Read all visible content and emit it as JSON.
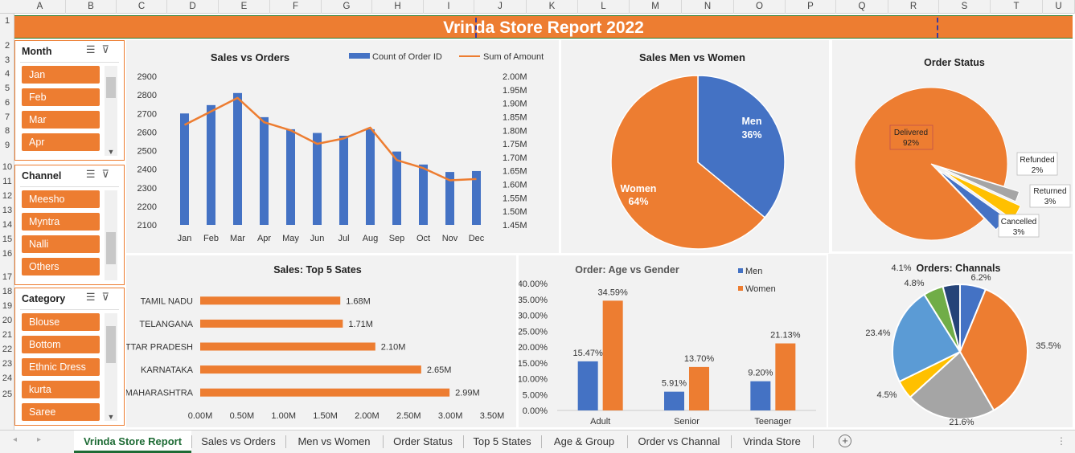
{
  "columns": [
    "A",
    "B",
    "C",
    "D",
    "E",
    "F",
    "G",
    "H",
    "I",
    "J",
    "K",
    "L",
    "M",
    "N",
    "O",
    "P",
    "Q",
    "R",
    "S",
    "T",
    "U"
  ],
  "rows": [
    "1",
    "2",
    "3",
    "4",
    "5",
    "6",
    "7",
    "8",
    "9",
    "10",
    "11",
    "12",
    "13",
    "14",
    "15",
    "16",
    "17",
    "18",
    "19",
    "20",
    "21",
    "22",
    "23",
    "24",
    "25"
  ],
  "report_title": "Vrinda Store Report 2022",
  "slicers": {
    "month": {
      "title": "Month",
      "items": [
        "Jan",
        "Feb",
        "Mar",
        "Apr"
      ]
    },
    "channel": {
      "title": "Channel",
      "items": [
        "Meesho",
        "Myntra",
        "Nalli",
        "Others"
      ]
    },
    "category": {
      "title": "Category",
      "items": [
        "Blouse",
        "Bottom",
        "Ethnic Dress",
        "kurta",
        "Saree"
      ]
    }
  },
  "colors": {
    "orange": "#ed7d31",
    "blue": "#4472c4",
    "gray": "#a5a5a5",
    "yellow": "#ffc000",
    "lightblue": "#5b9bd5",
    "green": "#70ad47",
    "navy": "#264478"
  },
  "chart_data": [
    {
      "type": "bar",
      "title": "Sales vs Orders",
      "categories": [
        "Jan",
        "Feb",
        "Mar",
        "Apr",
        "May",
        "Jun",
        "Jul",
        "Aug",
        "Sep",
        "Oct",
        "Nov",
        "Dec"
      ],
      "series": [
        {
          "name": "Count of Order ID",
          "values": [
            2700,
            2745,
            2810,
            2680,
            2615,
            2595,
            2580,
            2615,
            2495,
            2425,
            2385,
            2390
          ],
          "axis": "left"
        },
        {
          "name": "Sum of Amount",
          "values": [
            1.82,
            1.87,
            1.92,
            1.83,
            1.8,
            1.75,
            1.77,
            1.81,
            1.69,
            1.66,
            1.615,
            1.62
          ],
          "axis": "right",
          "type": "line"
        }
      ],
      "yticks": [
        "2100",
        "2200",
        "2300",
        "2400",
        "2500",
        "2600",
        "2700",
        "2800",
        "2900"
      ],
      "ylim": [
        2100,
        2900
      ],
      "y2ticks": [
        "1.45M",
        "1.50M",
        "1.55M",
        "1.60M",
        "1.65M",
        "1.70M",
        "1.75M",
        "1.80M",
        "1.85M",
        "1.90M",
        "1.95M",
        "2.00M"
      ],
      "y2lim": [
        1.45,
        2.0
      ]
    },
    {
      "type": "pie",
      "title": "Sales Men vs Women",
      "labels": [
        "Men",
        "Women"
      ],
      "values": [
        36,
        64
      ],
      "data_labels": [
        "36%",
        "64%"
      ]
    },
    {
      "type": "pie",
      "title": "Order Status",
      "labels": [
        "Delivered",
        "Refunded",
        "Returned",
        "Cancelled"
      ],
      "values": [
        92,
        2,
        3,
        3
      ],
      "data_labels": [
        "92%",
        "2%",
        "3%",
        "3%"
      ]
    },
    {
      "type": "bar",
      "orientation": "horizontal",
      "title": "Sales: Top 5 Sates",
      "categories": [
        "TAMIL NADU",
        "TELANGANA",
        "UTTAR PRADESH",
        "KARNATAKA",
        "MAHARASHTRA"
      ],
      "values": [
        1.68,
        1.71,
        2.1,
        2.65,
        2.99
      ],
      "data_labels": [
        "1.68M",
        "1.71M",
        "2.10M",
        "2.65M",
        "2.99M"
      ],
      "xticks": [
        "0.00M",
        "0.50M",
        "1.00M",
        "1.50M",
        "2.00M",
        "2.50M",
        "3.00M",
        "3.50M"
      ],
      "xlim": [
        0,
        3.5
      ]
    },
    {
      "type": "bar",
      "title": "Order: Age vs Gender",
      "categories": [
        "Adult",
        "Senior",
        "Teenager"
      ],
      "series": [
        {
          "name": "Men",
          "values": [
            15.47,
            5.91,
            9.2
          ],
          "data_labels": [
            "15.47%",
            "5.91%",
            "9.20%"
          ]
        },
        {
          "name": "Women",
          "values": [
            34.59,
            13.7,
            21.13
          ],
          "data_labels": [
            "34.59%",
            "13.70%",
            "21.13%"
          ]
        }
      ],
      "yticks": [
        "0.00%",
        "5.00%",
        "10.00%",
        "15.00%",
        "20.00%",
        "25.00%",
        "30.00%",
        "35.00%",
        "40.00%"
      ],
      "ylim": [
        0,
        40
      ]
    },
    {
      "type": "pie",
      "title": "Orders: Channals",
      "values": [
        6.2,
        35.5,
        21.6,
        4.5,
        23.4,
        4.8,
        4.1
      ],
      "data_labels": [
        "6.2%",
        "35.5%",
        "21.6%",
        "4.5%",
        "23.4%",
        "4.8%",
        "4.1%"
      ]
    }
  ],
  "tabs": [
    "Vrinda Store Report",
    "Sales vs Orders",
    "Men vs Women",
    "Order Status",
    "Top 5 States",
    "Age & Group",
    "Order vs Channal",
    "Vrinda Store"
  ],
  "active_tab": "Vrinda Store Report"
}
